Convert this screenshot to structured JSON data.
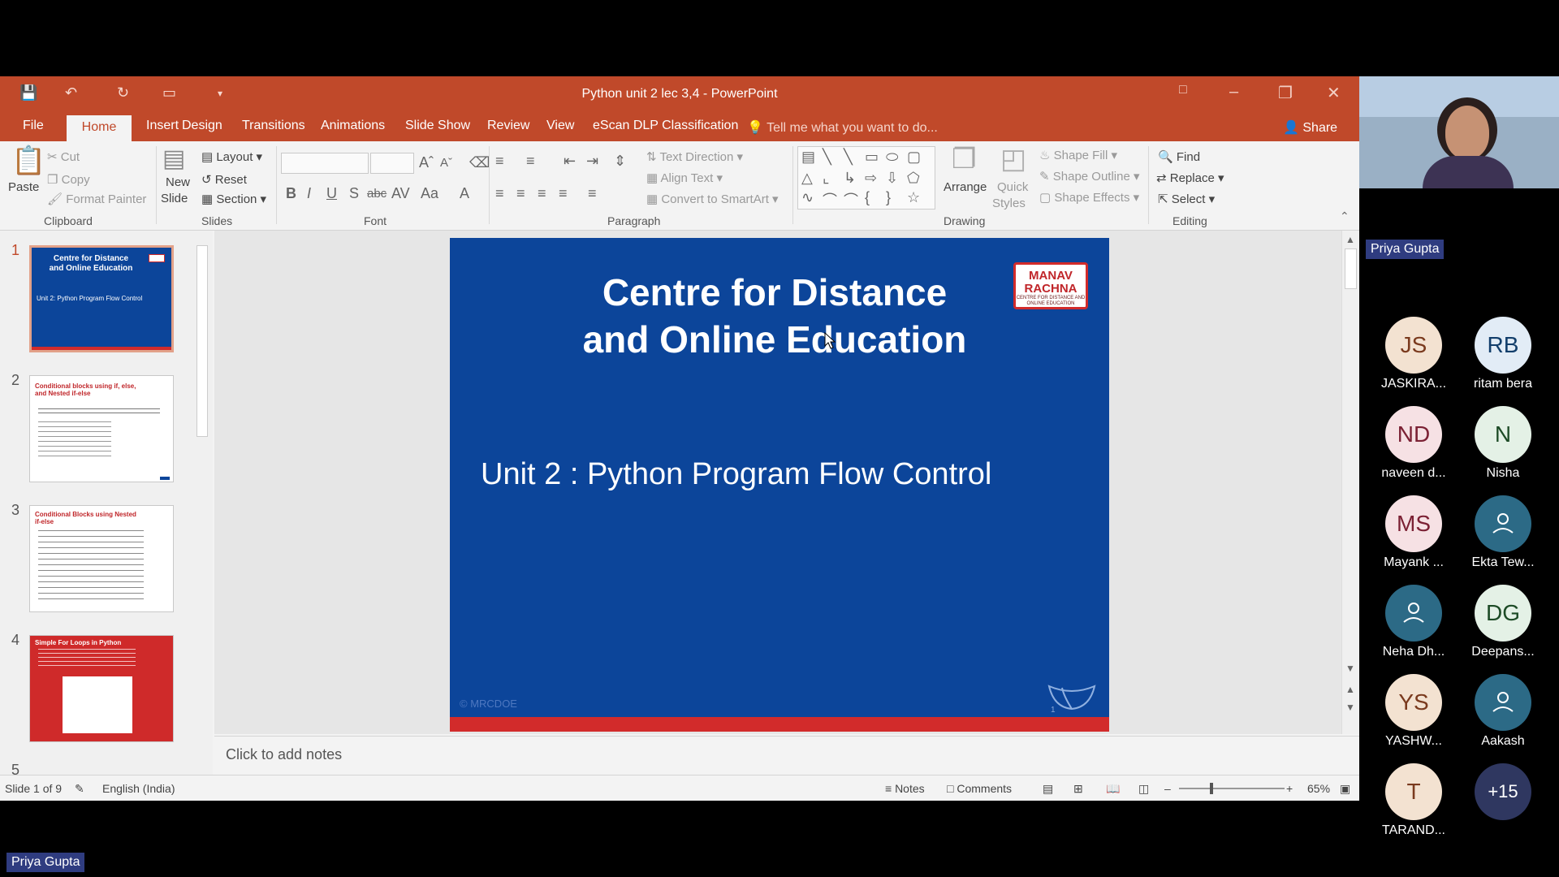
{
  "window": {
    "title": "Python unit 2 lec 3,4 - PowerPoint"
  },
  "tabs": {
    "file": "File",
    "home": "Home",
    "insert": "Insert",
    "design": "Design",
    "transitions": "Transitions",
    "animations": "Animations",
    "slideshow": "Slide Show",
    "review": "Review",
    "view": "View",
    "escan": "eScan DLP Classification",
    "tellme": "Tell me what you want to do...",
    "share": "Share"
  },
  "ribbon": {
    "paste": "Paste",
    "cut": "Cut",
    "copy": "Copy",
    "format_painter": "Format Painter",
    "clipboard": "Clipboard",
    "new_slide": "New",
    "new_slide_2": "Slide",
    "layout": "Layout",
    "reset": "Reset",
    "section": "Section",
    "slides": "Slides",
    "font": "Font",
    "text_direction": "Text Direction",
    "align_text": "Align Text",
    "convert_smartart": "Convert to SmartArt",
    "paragraph": "Paragraph",
    "arrange": "Arrange",
    "quick_styles": "Quick",
    "quick_styles_2": "Styles",
    "shape_fill": "Shape Fill",
    "shape_outline": "Shape Outline",
    "shape_effects": "Shape Effects",
    "drawing": "Drawing",
    "find": "Find",
    "replace": "Replace",
    "select": "Select",
    "editing": "Editing"
  },
  "thumbnails": [
    {
      "num": "1",
      "title": "Centre for Distance and Online Education",
      "sub": "Unit 2: Python Program Flow Control"
    },
    {
      "num": "2",
      "title": "Conditional blocks using if, else, and Nested if-else"
    },
    {
      "num": "3",
      "title": "Conditional Blocks using Nested if-else"
    },
    {
      "num": "4",
      "title": "Simple For Loops in Python"
    },
    {
      "num": "5"
    }
  ],
  "slide": {
    "title_line1": "Centre for Distance",
    "title_line2": "and Online Education",
    "subtitle": "Unit 2 : Python Program Flow Control",
    "logo_line1": "MANAV",
    "logo_line2": "RACHNA",
    "logo_line3": "CENTRE FOR DISTANCE AND ONLINE EDUCATION",
    "footer": "MRCDOE",
    "page_number": "1"
  },
  "notes_placeholder": "Click to add notes",
  "status": {
    "slide_of": "Slide 1 of 9",
    "language": "English (India)",
    "notes": "Notes",
    "comments": "Comments",
    "zoom": "65%"
  },
  "meeting": {
    "speaker": "Priya  Gupta",
    "bottom_tag": "Priya  Gupta",
    "participants": [
      {
        "initials": "JS",
        "name": "JASKIRA..."
      },
      {
        "initials": "RB",
        "name": "ritam bera"
      },
      {
        "initials": "ND",
        "name": "naveen d..."
      },
      {
        "initials": "N",
        "name": "Nisha"
      },
      {
        "initials": "MS",
        "name": "Mayank ..."
      },
      {
        "initials": "",
        "name": "Ekta Tew..."
      },
      {
        "initials": "",
        "name": "Neha Dh..."
      },
      {
        "initials": "DG",
        "name": "Deepans..."
      },
      {
        "initials": "YS",
        "name": "YASHW..."
      },
      {
        "initials": "",
        "name": "Aakash"
      },
      {
        "initials": "T",
        "name": "TARAND..."
      },
      {
        "initials": "+15",
        "name": ""
      }
    ]
  }
}
